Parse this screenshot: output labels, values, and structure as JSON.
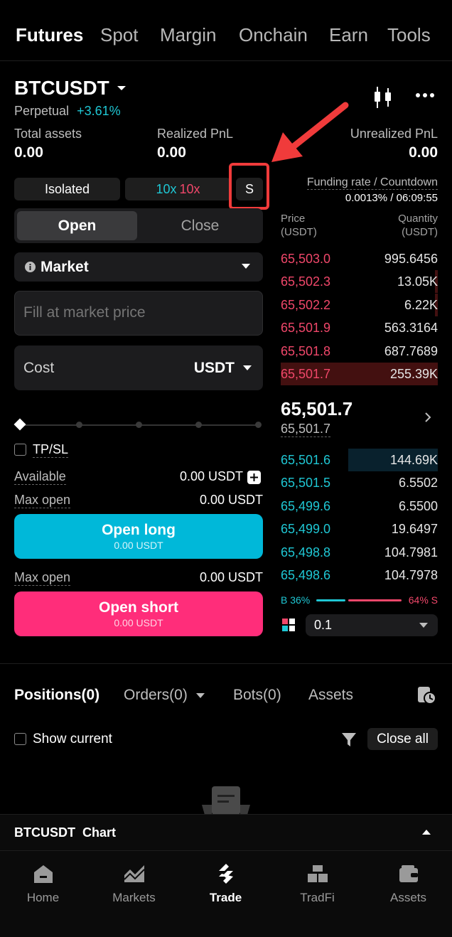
{
  "top_tabs": [
    "Futures",
    "Spot",
    "Margin",
    "Onchain",
    "Earn",
    "Tools"
  ],
  "symbol": {
    "name": "BTCUSDT",
    "type": "Perpetual",
    "change": "+3.61%"
  },
  "stats": {
    "total_assets_label": "Total assets",
    "total_assets": "0.00",
    "realized_label": "Realized PnL",
    "realized": "0.00",
    "unrealized_label": "Unrealized PnL",
    "unrealized": "0.00"
  },
  "margin": {
    "mode": "Isolated",
    "leverage_a": "10x",
    "leverage_b": "10x",
    "s_label": "S"
  },
  "funding": {
    "label": "Funding rate / Countdown",
    "value": "0.0013% / 06:09:55"
  },
  "order": {
    "open_tab": "Open",
    "close_tab": "Close",
    "type": "Market",
    "price_placeholder": "Fill at market price",
    "cost_label": "Cost",
    "cost_unit": "USDT",
    "tpsl_label": "TP/SL",
    "available_label": "Available",
    "available_value": "0.00 USDT",
    "max_open_label": "Max open",
    "max_open_long": "0.00 USDT",
    "open_long_label": "Open long",
    "open_long_sub": "0.00 USDT",
    "max_open_short": "0.00 USDT",
    "open_short_label": "Open short",
    "open_short_sub": "0.00 USDT"
  },
  "orderbook": {
    "price_header": "Price",
    "price_unit": "(USDT)",
    "qty_header": "Quantity",
    "qty_unit": "(USDT)",
    "asks": [
      {
        "price": "65,503.0",
        "qty": "995.6456",
        "depth": 0
      },
      {
        "price": "65,502.3",
        "qty": "13.05K",
        "depth": 0.02
      },
      {
        "price": "65,502.2",
        "qty": "6.22K",
        "depth": 0.02
      },
      {
        "price": "65,501.9",
        "qty": "563.3164",
        "depth": 0
      },
      {
        "price": "65,501.8",
        "qty": "687.7689",
        "depth": 0
      },
      {
        "price": "65,501.7",
        "qty": "255.39K",
        "depth": 1
      }
    ],
    "last_price": "65,501.7",
    "mark_price": "65,501.7",
    "bids": [
      {
        "price": "65,501.6",
        "qty": "144.69K",
        "depth": 0.57
      },
      {
        "price": "65,501.5",
        "qty": "6.5502",
        "depth": 0
      },
      {
        "price": "65,499.6",
        "qty": "6.5500",
        "depth": 0
      },
      {
        "price": "65,499.0",
        "qty": "19.6497",
        "depth": 0
      },
      {
        "price": "65,498.8",
        "qty": "104.7981",
        "depth": 0
      },
      {
        "price": "65,498.6",
        "qty": "104.7978",
        "depth": 0
      }
    ],
    "buy_ratio": "B 36%",
    "sell_ratio": "64% S",
    "buy_share": 0.36,
    "precision": "0.1"
  },
  "positions": {
    "tabs": [
      "Positions(0)",
      "Orders(0)",
      "Bots(0)",
      "Assets"
    ],
    "show_current": "Show current",
    "close_all": "Close all"
  },
  "chart_bar": {
    "label": "BTCUSDT  Chart"
  },
  "bottom_nav": [
    "Home",
    "Markets",
    "Trade",
    "TradFi",
    "Assets"
  ],
  "colors": {
    "green": "#1fc7d4",
    "red": "#f0476a",
    "long_btn": "#00b8d9",
    "short_btn": "#ff2d7a",
    "highlight": "#f03b3b"
  }
}
